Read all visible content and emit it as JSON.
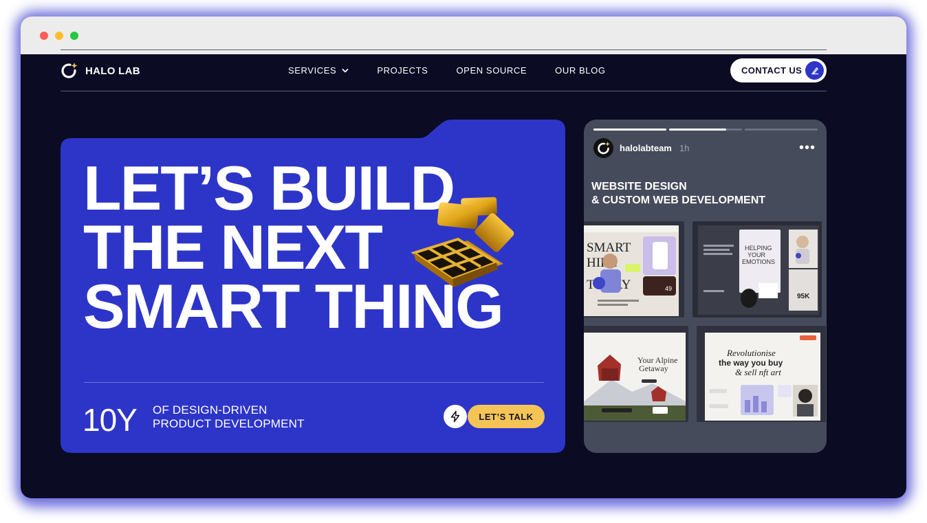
{
  "brand": {
    "name": "HALO LAB"
  },
  "nav": {
    "items": [
      {
        "label": "SERVICES",
        "has_dropdown": true
      },
      {
        "label": "PROJECTS"
      },
      {
        "label": "OPEN SOURCE"
      },
      {
        "label": "OUR BLOG"
      }
    ],
    "contact_label": "CONTACT US"
  },
  "hero": {
    "headline": [
      "LET’S BUILD",
      "THE NEXT",
      "SMART THING"
    ],
    "years": "10Y",
    "desc_line1": "OF DESIGN-DRIVEN",
    "desc_line2": "PRODUCT DEVELOPMENT",
    "cta_label": "LET’S TALK"
  },
  "story": {
    "username": "halolabteam",
    "time": "1h",
    "more": "•••",
    "title_line1": "WEBSITE DESIGN",
    "title_line2": "& CUSTOM WEB DEVELOPMENT",
    "progress": [
      1.0,
      0.78,
      0.0
    ],
    "thumbs": {
      "t1": {
        "line1": "SMART",
        "line2": "HIRE",
        "line3": "TODAY",
        "price": "49"
      },
      "t2": {
        "line1": "HELPING",
        "line2": "YOUR",
        "line3": "EMOTIONS",
        "stat": "95K"
      },
      "t3": {
        "line1": "Your Alpine",
        "line2": "Getaway"
      },
      "t4": {
        "line1": "Revolutionise",
        "line2": "the   way you buy",
        "line3": "& sell nft art"
      }
    }
  },
  "colors": {
    "page_bg": "#0b0b24",
    "hero_blue": "#2d35c8",
    "accent_yellow": "#f5c456",
    "story_bg": "#464b5c",
    "glow": "#3d3ed0"
  },
  "icons": [
    "logo-icon",
    "chevron-down-icon",
    "pen-icon",
    "lightning-icon",
    "more-icon",
    "cube-illustration"
  ]
}
